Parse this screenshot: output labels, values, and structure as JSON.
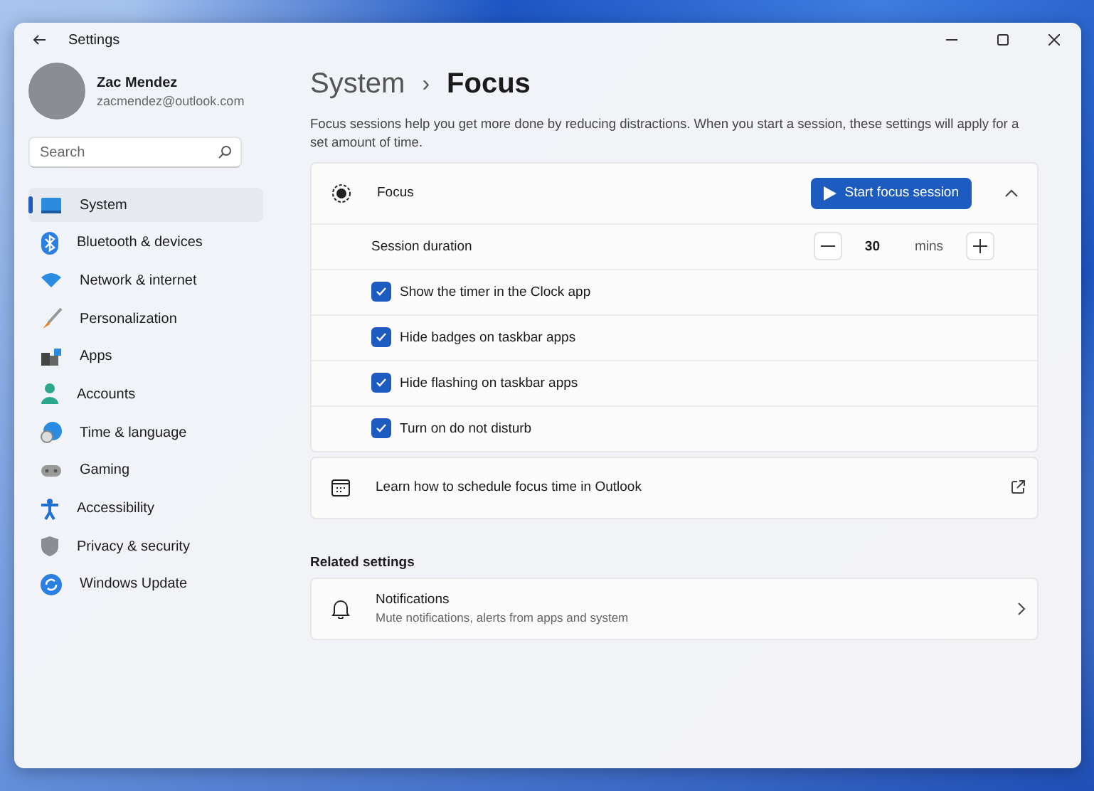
{
  "window": {
    "title": "Settings"
  },
  "profile": {
    "name": "Zac Mendez",
    "email": "zacmendez@outlook.com"
  },
  "search": {
    "placeholder": "Search"
  },
  "sidebar": {
    "items": [
      {
        "label": "System",
        "selected": true
      },
      {
        "label": "Bluetooth & devices",
        "selected": false
      },
      {
        "label": "Network & internet",
        "selected": false
      },
      {
        "label": "Personalization",
        "selected": false
      },
      {
        "label": "Apps",
        "selected": false
      },
      {
        "label": "Accounts",
        "selected": false
      },
      {
        "label": "Time & language",
        "selected": false
      },
      {
        "label": "Gaming",
        "selected": false
      },
      {
        "label": "Accessibility",
        "selected": false
      },
      {
        "label": "Privacy & security",
        "selected": false
      },
      {
        "label": "Windows Update",
        "selected": false
      }
    ]
  },
  "breadcrumb": {
    "parent": "System",
    "separator": "›",
    "current": "Focus"
  },
  "description": "Focus sessions help you get more done by reducing distractions. When you start a session, these settings will apply for a set amount of time.",
  "focus_card": {
    "title": "Focus",
    "button": "Start focus session",
    "expanded": true,
    "duration": {
      "label": "Session duration",
      "value": "30",
      "unit": "mins"
    },
    "options": [
      {
        "label": "Show the timer in the Clock app",
        "checked": true
      },
      {
        "label": "Hide badges on taskbar apps",
        "checked": true
      },
      {
        "label": "Hide flashing on taskbar apps",
        "checked": true
      },
      {
        "label": "Turn on do not disturb",
        "checked": true
      }
    ]
  },
  "outlook_link": {
    "label": "Learn how to schedule focus time in Outlook"
  },
  "related": {
    "heading": "Related settings",
    "items": [
      {
        "title": "Notifications",
        "subtitle": "Mute notifications, alerts from apps and system"
      }
    ]
  }
}
